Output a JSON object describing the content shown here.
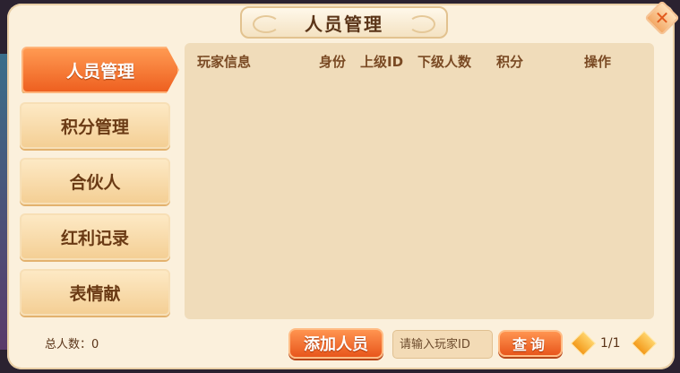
{
  "window": {
    "title": "人员管理",
    "close_icon": "close-icon"
  },
  "tabs": [
    {
      "label": "人员管理",
      "active": true
    },
    {
      "label": "积分管理",
      "active": false
    },
    {
      "label": "合伙人",
      "active": false
    },
    {
      "label": "红利记录",
      "active": false
    },
    {
      "label": "表情献",
      "active": false
    }
  ],
  "table": {
    "headers": [
      "玩家信息",
      "身份",
      "上级ID",
      "下级人数",
      "积分",
      "操作"
    ],
    "rows": []
  },
  "footer": {
    "total_label": "总人数：",
    "total_value": "0",
    "add_button": "添加人员",
    "search_placeholder": "请输入玩家ID",
    "query_button": "查询",
    "page": "1/1"
  },
  "colors": {
    "accent": "#ee6020",
    "panel": "#fbf0dc",
    "content": "#f0dcba",
    "text": "#5a3418"
  }
}
